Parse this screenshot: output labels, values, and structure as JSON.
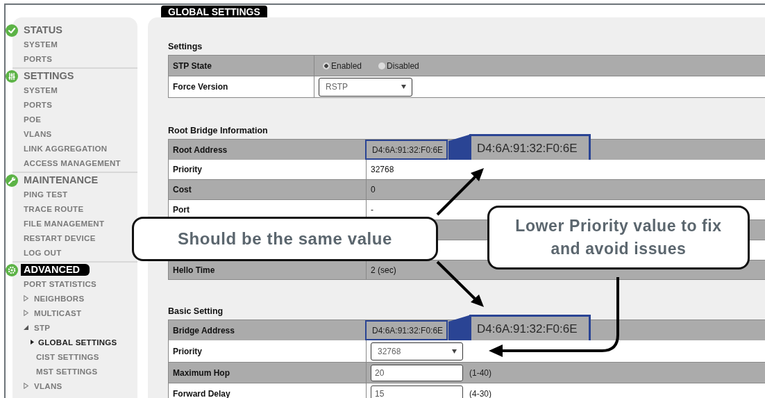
{
  "sidebar": {
    "sections": [
      {
        "title": "STATUS",
        "selected": false,
        "items": [
          {
            "label": "SYSTEM",
            "selected": false
          },
          {
            "label": "PORTS",
            "selected": false
          }
        ]
      },
      {
        "title": "SETTINGS",
        "selected": false,
        "items": [
          {
            "label": "SYSTEM",
            "selected": false
          },
          {
            "label": "PORTS",
            "selected": false
          },
          {
            "label": "POE",
            "selected": false
          },
          {
            "label": "VLANS",
            "selected": false
          },
          {
            "label": "LINK AGGREGATION",
            "selected": false
          },
          {
            "label": "ACCESS MANAGEMENT",
            "selected": false
          }
        ]
      },
      {
        "title": "MAINTENANCE",
        "selected": false,
        "items": [
          {
            "label": "PING TEST",
            "selected": false
          },
          {
            "label": "TRACE ROUTE",
            "selected": false
          },
          {
            "label": "FILE MANAGEMENT",
            "selected": false
          },
          {
            "label": "RESTART DEVICE",
            "selected": false
          },
          {
            "label": "LOG OUT",
            "selected": false
          }
        ]
      },
      {
        "title": "ADVANCED",
        "selected": true,
        "items": [
          {
            "label": "PORT STATISTICS",
            "selected": false
          },
          {
            "label": "NEIGHBORS",
            "selected": false,
            "expanded": false
          },
          {
            "label": "MULTICAST",
            "selected": false,
            "expanded": false
          },
          {
            "label": "STP",
            "selected": false,
            "expanded": true,
            "children": [
              {
                "label": "GLOBAL SETTINGS",
                "selected": true
              },
              {
                "label": "CIST SETTINGS",
                "selected": false
              },
              {
                "label": "MST SETTINGS",
                "selected": false
              }
            ]
          },
          {
            "label": "VLANS",
            "selected": false,
            "expanded": false
          }
        ]
      }
    ]
  },
  "page": {
    "title": "GLOBAL SETTINGS",
    "sections": [
      {
        "heading": "Settings",
        "rows": [
          {
            "kind": "radio",
            "label": "STP State",
            "options": [
              {
                "label": "Enabled",
                "selected": true
              },
              {
                "label": "Disabled",
                "selected": false
              }
            ]
          },
          {
            "kind": "select",
            "label": "Force Version",
            "value": "RSTP"
          }
        ]
      },
      {
        "heading": "Root Bridge Information",
        "rows": [
          {
            "kind": "text",
            "label": "Root Address",
            "value": "D4:6A:91:32:F0:6E",
            "magnified_value": "D4:6A:91:32:F0:6E"
          },
          {
            "kind": "text",
            "label": "Priority",
            "value": "32768"
          },
          {
            "kind": "text",
            "label": "Cost",
            "value": "0"
          },
          {
            "kind": "text",
            "label": "Port",
            "value": "-"
          },
          {
            "kind": "text"
          },
          {
            "kind": "text"
          },
          {
            "kind": "text",
            "label": "Hello Time",
            "value": "2 (sec)"
          }
        ]
      },
      {
        "heading": "Basic Setting",
        "rows": [
          {
            "kind": "text",
            "label": "Bridge Address",
            "value": "D4:6A:91:32:F0:6E",
            "magnified_value": "D4:6A:91:32:F0:6E"
          },
          {
            "kind": "select",
            "label": "Priority",
            "value": "32768"
          },
          {
            "kind": "input",
            "label": "Maximum Hop",
            "value": "20",
            "hint": "(1-40)"
          },
          {
            "kind": "input",
            "label": "Forward Delay",
            "value": "15",
            "hint": "(4-30)"
          }
        ]
      }
    ]
  },
  "callouts": [
    {
      "text": "Should be the same value"
    },
    {
      "text": "Lower Priority value to fix and avoid issues"
    }
  ]
}
